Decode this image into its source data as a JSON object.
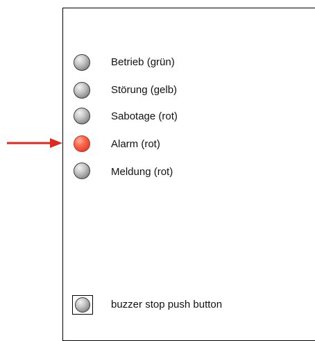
{
  "indicators": [
    {
      "label": "Betrieb (grün)",
      "state": "off",
      "color": "#8c8c8c"
    },
    {
      "label": "Störung (gelb)",
      "state": "off",
      "color": "#8c8c8c"
    },
    {
      "label": "Sabotage (rot)",
      "state": "off",
      "color": "#8c8c8c"
    },
    {
      "label": "Alarm (rot)",
      "state": "on",
      "color": "#e0432b"
    },
    {
      "label": "Meldung (rot)",
      "state": "off",
      "color": "#8c8c8c"
    }
  ],
  "highlight_marker": {
    "target": "Alarm (rot)",
    "color": "#e02a1f",
    "icon": "arrow-right-icon"
  },
  "buzzer": {
    "label": "buzzer stop push button",
    "icon": "push-button-icon"
  }
}
